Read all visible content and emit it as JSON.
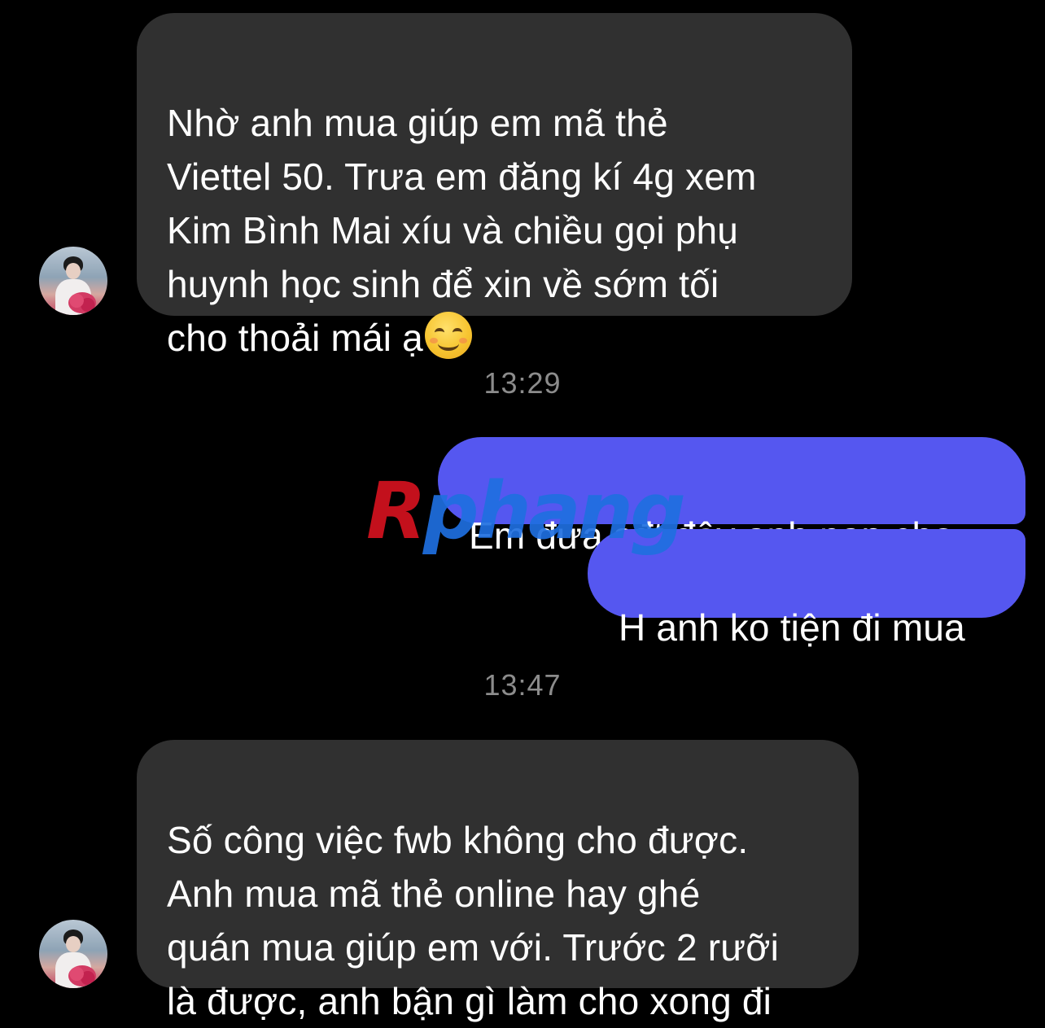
{
  "conversation": {
    "messages": [
      {
        "direction": "incoming",
        "text": "Nhờ anh mua giúp em mã thẻ\nViettel 50. Trưa em đăng kí 4g xem\nKim Bình Mai xíu và chiều gọi phụ\nhuynh học sinh để xin về sớm tối\ncho thoải mái ạ",
        "emoji": "smiling-face-emoji"
      },
      {
        "type": "timestamp",
        "text": "13:29"
      },
      {
        "direction": "outgoing",
        "text": "Em đưa sđt đây anh nạp cho"
      },
      {
        "direction": "outgoing",
        "text": "H anh ko tiện đi mua"
      },
      {
        "type": "timestamp",
        "text": "13:47"
      },
      {
        "direction": "incoming",
        "text": "Số công việc fwb không cho được.\nAnh mua mã thẻ online hay ghé\nquán mua giúp em với. Trước 2 rưỡi\nlà được, anh bận gì làm cho xong đi"
      }
    ]
  },
  "watermark": {
    "first": "R",
    "rest": "phang"
  },
  "colors": {
    "background": "#000000",
    "incoming_bubble": "#303030",
    "outgoing_bubble": "#5557f0",
    "timestamp_text": "#8c8c8c"
  }
}
